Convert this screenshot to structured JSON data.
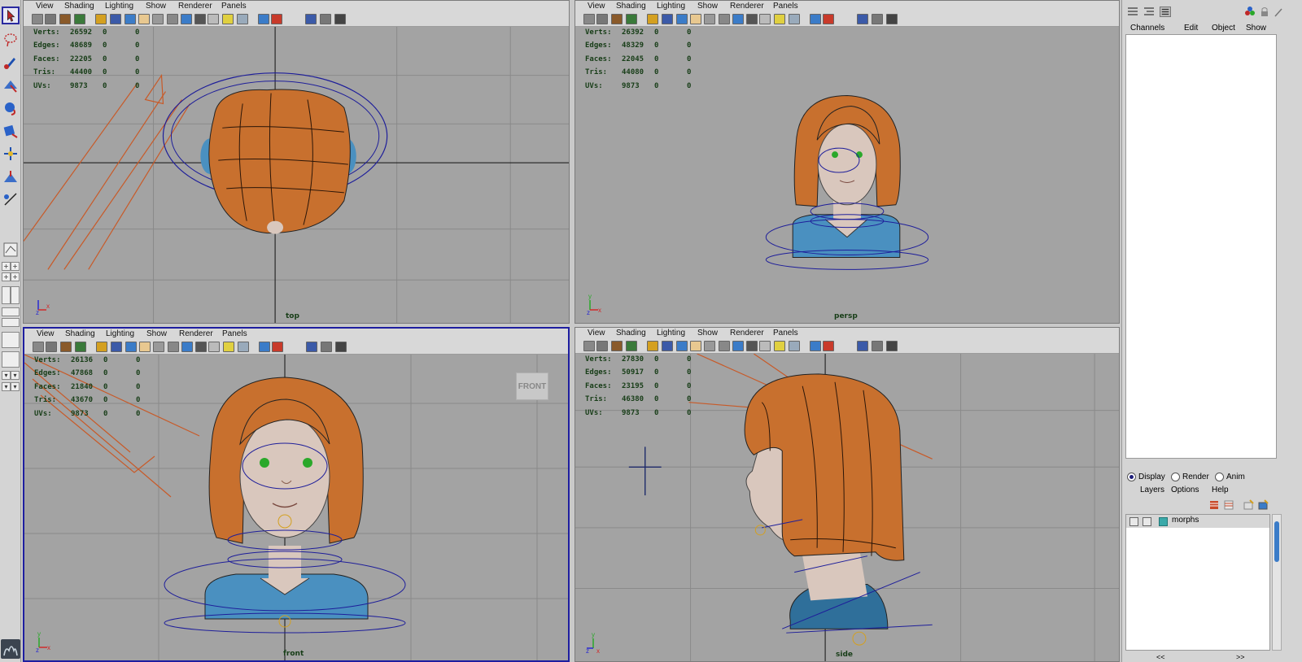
{
  "viewport_menu": [
    "View",
    "Shading",
    "Lighting",
    "Show",
    "Renderer",
    "Panels"
  ],
  "hud_labels": [
    "Verts:",
    "Edges:",
    "Faces:",
    "Tris:",
    "UVs:"
  ],
  "panels": {
    "top": {
      "camera": "top",
      "stats": [
        [
          "26592",
          "0",
          "0"
        ],
        [
          "48689",
          "0",
          "0"
        ],
        [
          "22205",
          "0",
          "0"
        ],
        [
          "44400",
          "0",
          "0"
        ],
        [
          "9873",
          "0",
          "0"
        ]
      ]
    },
    "persp": {
      "camera": "persp",
      "stats": [
        [
          "26392",
          "0",
          "0"
        ],
        [
          "48329",
          "0",
          "0"
        ],
        [
          "22045",
          "0",
          "0"
        ],
        [
          "44080",
          "0",
          "0"
        ],
        [
          "9873",
          "0",
          "0"
        ]
      ]
    },
    "front": {
      "camera": "front",
      "stats": [
        [
          "26136",
          "0",
          "0"
        ],
        [
          "47868",
          "0",
          "0"
        ],
        [
          "21840",
          "0",
          "0"
        ],
        [
          "43670",
          "0",
          "0"
        ],
        [
          "9873",
          "0",
          "0"
        ]
      ],
      "viewcube": "FRONT"
    },
    "side": {
      "camera": "side",
      "stats": [
        [
          "27830",
          "0",
          "0"
        ],
        [
          "50917",
          "0",
          "0"
        ],
        [
          "23195",
          "0",
          "0"
        ],
        [
          "46380",
          "0",
          "0"
        ],
        [
          "9873",
          "0",
          "0"
        ]
      ]
    }
  },
  "axis": {
    "y": "y",
    "z": "z",
    "x": "x"
  },
  "channel_box": {
    "menu": [
      "Channels",
      "Edit",
      "Object",
      "Show"
    ]
  },
  "layer_editor": {
    "tabs": [
      {
        "label": "Display",
        "selected": true
      },
      {
        "label": "Render",
        "selected": false
      },
      {
        "label": "Anim",
        "selected": false
      }
    ],
    "menu": [
      "Layers",
      "Options",
      "Help"
    ],
    "layers": [
      {
        "name": "morphs",
        "color": "#3aa9a9"
      }
    ],
    "prev": "<<",
    "next": ">>"
  },
  "colors": {
    "viewport_bg": "#a3a3a3",
    "hair": "#c8702e",
    "skin": "#d9c7bd",
    "shirt": "#4a90c0",
    "rig": "#1e1e9a",
    "active_border": "#1e1ea0"
  }
}
